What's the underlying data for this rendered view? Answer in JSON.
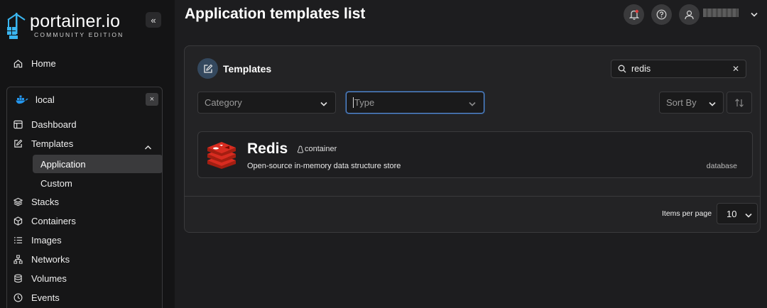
{
  "brand": {
    "title": "portainer.io",
    "subtitle": "COMMUNITY EDITION",
    "collapse_icon": "chevrons-left-icon"
  },
  "sidebar": {
    "home": "Home",
    "environment": {
      "name": "local",
      "close": "×"
    },
    "items": [
      {
        "label": "Dashboard",
        "icon": "dashboard-icon"
      },
      {
        "label": "Templates",
        "icon": "edit-icon"
      },
      {
        "label": "Application",
        "icon": ""
      },
      {
        "label": "Custom",
        "icon": ""
      },
      {
        "label": "Stacks",
        "icon": "layers-icon"
      },
      {
        "label": "Containers",
        "icon": "box-icon"
      },
      {
        "label": "Images",
        "icon": "list-icon"
      },
      {
        "label": "Networks",
        "icon": "network-icon"
      },
      {
        "label": "Volumes",
        "icon": "database-icon"
      },
      {
        "label": "Events",
        "icon": "clock-icon"
      }
    ]
  },
  "header": {
    "title": "Application templates list"
  },
  "panel": {
    "title": "Templates",
    "search": {
      "value": "redis"
    },
    "filters": {
      "category_placeholder": "Category",
      "type_placeholder": "Type",
      "sort_label": "Sort By"
    },
    "templates": [
      {
        "name": "Redis",
        "type": "container",
        "description": "Open-source in-memory data structure store",
        "category": "database"
      }
    ],
    "pagination": {
      "items_per_page_label": "Items per page",
      "items_per_page": "10"
    }
  },
  "colors": {
    "accent": "#5c8ed6",
    "redis_red": "#d82c20",
    "bg": "#1d1d1f",
    "sidebar": "#141415"
  }
}
